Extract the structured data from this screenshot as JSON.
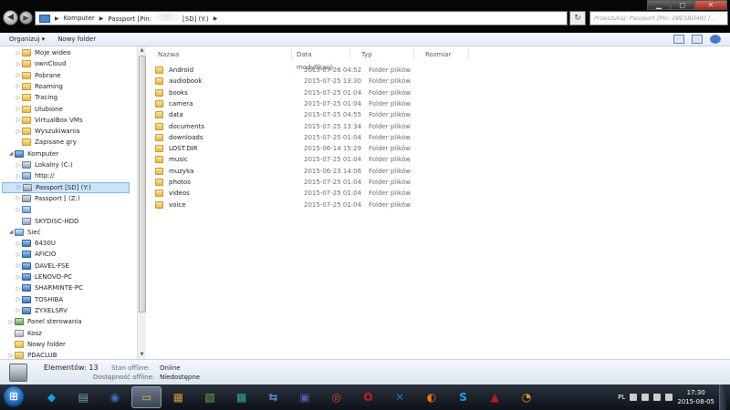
{
  "window": {
    "min_label": "▁",
    "max_label": "◻",
    "close_label": "✕"
  },
  "address": {
    "part1": "Komputer",
    "part2": "Passport [Pin:",
    "part3": "[SD] (Y:)"
  },
  "search": {
    "placeholder": "Przeszukaj: Passport [Pin: 2BE5BD4B] [..."
  },
  "toolbar": {
    "organize": "Organizuj ▾",
    "new_folder": "Nowy folder"
  },
  "nav": {
    "items": [
      {
        "label": "Moje wideo",
        "icon": "folder",
        "arrow": "▷"
      },
      {
        "label": "ownCloud",
        "icon": "folder",
        "arrow": "▷"
      },
      {
        "label": "Pobrane",
        "icon": "folder",
        "arrow": "▷"
      },
      {
        "label": "Roaming",
        "icon": "folder",
        "arrow": "▷"
      },
      {
        "label": "Tracing",
        "icon": "folder",
        "arrow": "▷"
      },
      {
        "label": "Ulubione",
        "icon": "folder",
        "arrow": "▷"
      },
      {
        "label": "VirtualBox VMs",
        "icon": "folder",
        "arrow": "▷"
      },
      {
        "label": "Wyszukiwania",
        "icon": "folder",
        "arrow": "▷"
      },
      {
        "label": "Zapisane gry",
        "icon": "folder",
        "arrow": ""
      },
      {
        "label": "Komputer",
        "icon": "pc",
        "arrow": "◢"
      },
      {
        "label": "Lokalny (C:)",
        "icon": "drive",
        "arrow": "▷"
      },
      {
        "label": "http://",
        "icon": "net",
        "arrow": "▷"
      },
      {
        "label": "Passport [SD] (Y:)",
        "icon": "drive",
        "arrow": "▷"
      },
      {
        "label": "Passport [ (Z:)",
        "icon": "drive",
        "arrow": "▷"
      },
      {
        "label": "",
        "icon": "net",
        "arrow": "▷"
      },
      {
        "label": "SKYDISC-HDD",
        "icon": "drive",
        "arrow": ""
      },
      {
        "label": "Sieć",
        "icon": "net",
        "arrow": "◢"
      },
      {
        "label": "6430U",
        "icon": "pc",
        "arrow": "▷"
      },
      {
        "label": "AFICIO",
        "icon": "pc",
        "arrow": "▷"
      },
      {
        "label": "DAVEL-FSE",
        "icon": "pc",
        "arrow": "▷"
      },
      {
        "label": "LENOVO-PC",
        "icon": "pc",
        "arrow": "▷"
      },
      {
        "label": "SHARMINTE-PC",
        "icon": "pc",
        "arrow": "▷"
      },
      {
        "label": "TOSHIBA",
        "icon": "pc",
        "arrow": "▷"
      },
      {
        "label": "ZYXELSRV",
        "icon": "pc",
        "arrow": "▷"
      },
      {
        "label": "Panel sterowania",
        "icon": "panel",
        "arrow": "▷"
      },
      {
        "label": "Kosz",
        "icon": "bin",
        "arrow": ""
      },
      {
        "label": "Nowy folder",
        "icon": "folder",
        "arrow": ""
      },
      {
        "label": "PDACLUB",
        "icon": "folder",
        "arrow": "▷"
      }
    ]
  },
  "columns": {
    "name": "Nazwa",
    "date": "Data modyfikacji",
    "type": "Typ",
    "size": "Rozmiar"
  },
  "files": [
    {
      "name": "Android",
      "date": "2015-07-26 04:52",
      "type": "Folder plików"
    },
    {
      "name": "audiobook",
      "date": "2015-07-25 13:30",
      "type": "Folder plików"
    },
    {
      "name": "books",
      "date": "2015-07-25 01:04",
      "type": "Folder plików"
    },
    {
      "name": "camera",
      "date": "2015-07-25 01:04",
      "type": "Folder plików"
    },
    {
      "name": "data",
      "date": "2015-07-25 04:55",
      "type": "Folder plików"
    },
    {
      "name": "documents",
      "date": "2015-07-25 13:34",
      "type": "Folder plików"
    },
    {
      "name": "downloads",
      "date": "2015-07-25 01:04",
      "type": "Folder plików"
    },
    {
      "name": "LOST.DIR",
      "date": "2015-06-14 15:29",
      "type": "Folder plików"
    },
    {
      "name": "music",
      "date": "2015-07-25 01:04",
      "type": "Folder plików"
    },
    {
      "name": "muzyka",
      "date": "2015-06-23 14:06",
      "type": "Folder plików"
    },
    {
      "name": "photos",
      "date": "2015-07-25 01:04",
      "type": "Folder plików"
    },
    {
      "name": "videos",
      "date": "2015-07-25 01:04",
      "type": "Folder plików"
    },
    {
      "name": "voice",
      "date": "2015-07-25 01:04",
      "type": "Folder plików"
    }
  ],
  "details": {
    "count": "Elementów: 13",
    "offline_status_label": "Stan offline:",
    "offline_status_value": "Online",
    "offline_avail_label": "Dostępność offline:",
    "offline_avail_value": "Niedostępne"
  },
  "taskbar": {
    "start": "⊞",
    "apps": [
      "kodi",
      "network",
      "thunderbird",
      "explorer",
      "files",
      "notepad",
      "chart",
      "transfer",
      "save",
      "chrome",
      "opera",
      "teamviewer",
      "firefox",
      "skype",
      "acrobat",
      "recorder"
    ],
    "lang": "PL",
    "time": "17:30",
    "date": "2015-08-05"
  }
}
